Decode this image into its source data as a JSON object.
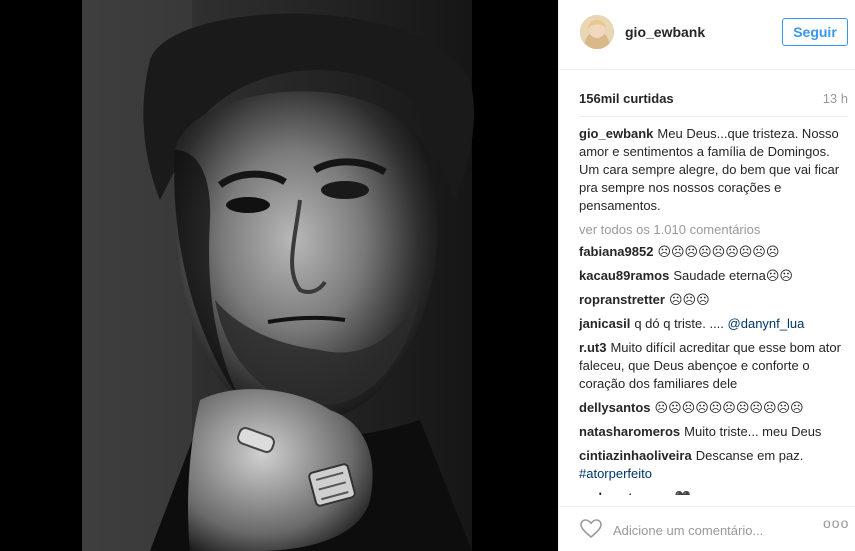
{
  "post": {
    "username": "gio_ewbank",
    "follow_label": "Seguir",
    "likes": "156mil curtidas",
    "time": "13 h",
    "caption": {
      "user": "gio_ewbank",
      "text": "Meu Deus...que tristeza. Nosso amor e sentimentos a família de Domingos. Um cara sempre alegre, do bem que vai ficar pra sempre nos nossos corações e pensamentos."
    },
    "view_all": "ver todos os 1.010 comentários"
  },
  "comments": [
    {
      "user": "fabiana9852",
      "text": "☹☹☹☹☹☹☹☹☹"
    },
    {
      "user": "kacau89ramos",
      "text": "Saudade eterna☹☹"
    },
    {
      "user": "ropranstretter",
      "text": "☹☹☹"
    },
    {
      "user": "janicasil",
      "text": "q dó q triste. ....",
      "mention": "@danynf_lua"
    },
    {
      "user": "r.ut3",
      "text": "Muito difícil acreditar que esse bom ator faleceu, que Deus abençoe e conforte o coração dos familiares dele"
    },
    {
      "user": "dellysantos",
      "text": "☹☹☹☹☹☹☹☹☹☹☹"
    },
    {
      "user": "natasharomeros",
      "text": "Muito triste... meu Deus"
    },
    {
      "user": "cintiazinhaoliveira",
      "text": "Descanse em paz.",
      "tag": "#atorperfeito"
    },
    {
      "user": "andrezatuanny",
      "text": "🖤"
    }
  ],
  "bottom": {
    "placeholder": "Adicione um comentário...",
    "more_label": "ooo",
    "heart_icon": "heart-outline-icon"
  },
  "colors": {
    "accent": "#3897f0",
    "link": "#003569",
    "muted": "#999999"
  }
}
